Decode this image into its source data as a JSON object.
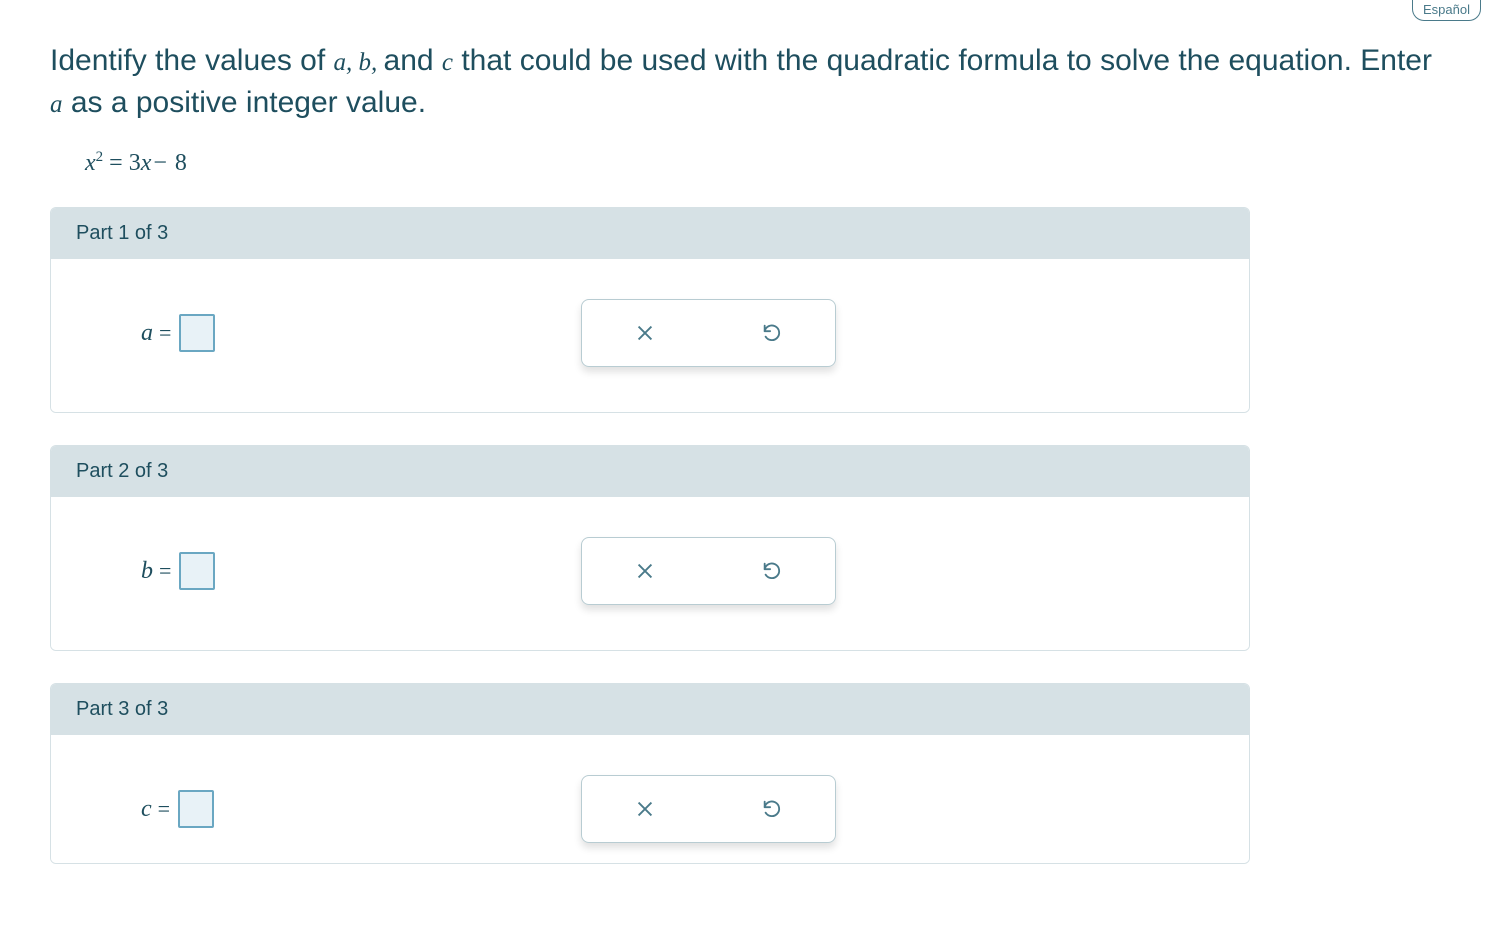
{
  "language_label": "Español",
  "question": {
    "part1": "Identify the values of ",
    "var_a": "a",
    "sep1": ", ",
    "var_b": "b",
    "sep2": ", ",
    "and": "and ",
    "var_c": "c",
    "part2": " that could be used with the quadratic formula to solve the equation. Enter ",
    "var_a2": "a",
    "part3": " as a positive integer value."
  },
  "equation": {
    "lhs_var": "x",
    "lhs_exp": "2",
    "equals": " = ",
    "rhs_coef": "3",
    "rhs_var": "x",
    "minus": "−",
    "rhs_const": " 8"
  },
  "parts": [
    {
      "header": "Part 1 of 3",
      "label": "a"
    },
    {
      "header": "Part 2 of 3",
      "label": "b"
    },
    {
      "header": "Part 3 of 3",
      "label": "c"
    }
  ],
  "equals_sign": "="
}
